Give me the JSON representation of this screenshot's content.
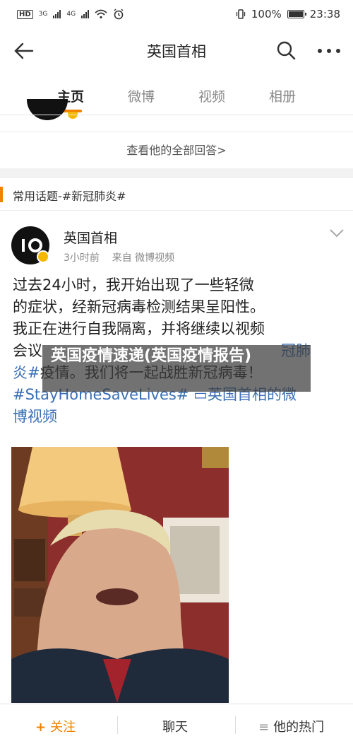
{
  "status_bar": {
    "network_hd": "HD",
    "net1": "3G",
    "net2": "4G",
    "battery_pct": "100%",
    "battery_level": 1.0,
    "time": "23:38"
  },
  "header": {
    "title": "英国首相",
    "back_icon": "back-arrow-icon",
    "search_icon": "search-icon",
    "more_icon": "more-dots-icon"
  },
  "tabs": [
    {
      "label": "主页",
      "active": true
    },
    {
      "label": "微博",
      "active": false
    },
    {
      "label": "视频",
      "active": false
    },
    {
      "label": "相册",
      "active": false
    }
  ],
  "all_replies_link": "查看他的全部回答>",
  "topic_bar": {
    "text": "常用话题-#新冠肺炎#"
  },
  "post": {
    "author": "英国首相",
    "avatar_text": "I O",
    "time": "3小时前",
    "source": "来自 微博视频",
    "body_lines": [
      {
        "text": "过去24小时，我开始出现了一些轻微"
      },
      {
        "text": "的症状，经新冠病毒检测结果呈阳性。"
      },
      {
        "text": "我正在进行自我隔离，并将继续以视频"
      },
      {
        "text": "会议"
      },
      {
        "text": "炎#疫情。我们将一起战胜新冠病毒！"
      },
      {
        "text": "#StayHomeSaveLives#  ▭英国首相的微"
      },
      {
        "text": "博视频"
      }
    ],
    "hidden_tail": "冠肺"
  },
  "overlay_caption": "英国疫情速递(英国疫情报告)",
  "bottom_bar": {
    "follow": "关注",
    "chat": "聊天",
    "hot": "他的热门"
  },
  "colors": {
    "accent": "#f08200",
    "link": "#3a6fb5",
    "badge": "#f5b800"
  }
}
